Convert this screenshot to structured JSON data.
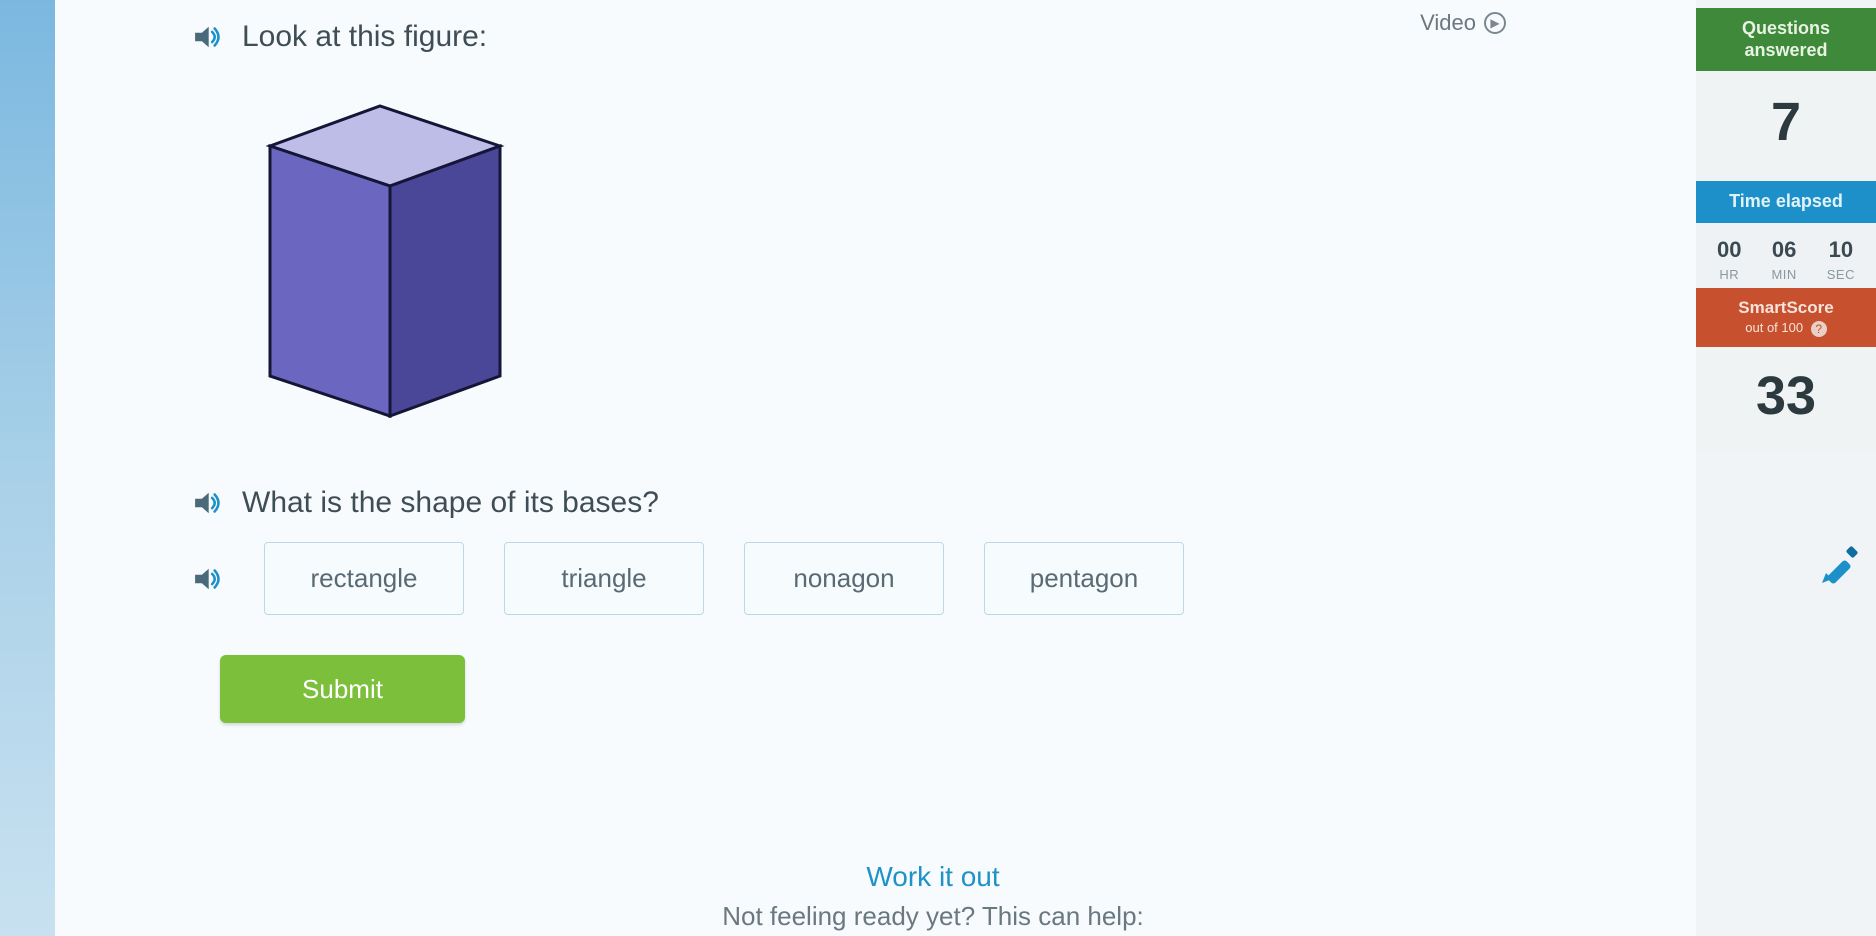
{
  "header": {
    "video_label": "Video"
  },
  "question": {
    "prompt1": "Look at this figure:",
    "prompt2": "What is the shape of its bases?",
    "choices": [
      "rectangle",
      "triangle",
      "nonagon",
      "pentagon"
    ],
    "submit_label": "Submit"
  },
  "footer": {
    "work_it_out": "Work it out",
    "not_ready": "Not feeling ready yet? This can help:"
  },
  "sidebar": {
    "questions_answered_label": "Questions answered",
    "questions_answered_value": "7",
    "time_label": "Time elapsed",
    "time": {
      "hr": {
        "value": "00",
        "label": "HR"
      },
      "min": {
        "value": "06",
        "label": "MIN"
      },
      "sec": {
        "value": "10",
        "label": "SEC"
      }
    },
    "smartscore_label": "SmartScore",
    "smartscore_sub": "out of 100",
    "smartscore_value": "33"
  }
}
